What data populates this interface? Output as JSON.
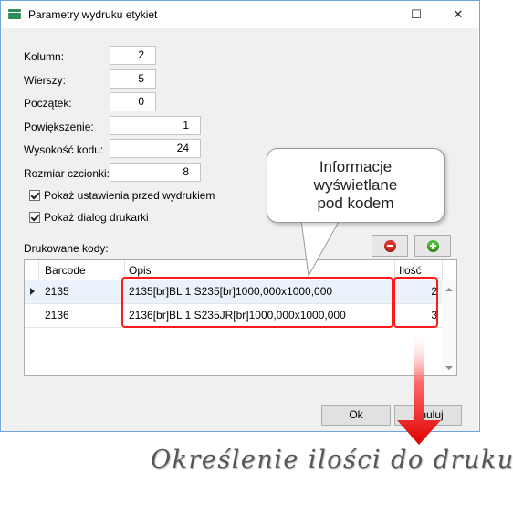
{
  "window": {
    "title": "Parametry wydruku etykiet",
    "controls": {
      "minimize": "—",
      "maximize": "☐",
      "close": "✕"
    }
  },
  "form": {
    "kolumn": {
      "label": "Kolumn:",
      "value": "2"
    },
    "wierszy": {
      "label": "Wierszy:",
      "value": "5"
    },
    "poczatek": {
      "label": "Początek:",
      "value": "0"
    },
    "powiekszenie": {
      "label": "Powiększenie:",
      "value": "1"
    },
    "wysokosc": {
      "label": "Wysokość kodu:",
      "value": "24"
    },
    "rozmiar": {
      "label": "Rozmiar czcionki:",
      "value": "8"
    },
    "check_settings": {
      "label": "Pokaż ustawienia przed wydrukiem",
      "checked": true
    },
    "check_dialog": {
      "label": "Pokaż dialog drukarki",
      "checked": true
    }
  },
  "codes": {
    "label": "Drukowane kody:",
    "columns": [
      "Barcode",
      "Opis",
      "Ilość"
    ],
    "rows": [
      {
        "barcode": "2135",
        "opis": "2135[br]BL 1 S235[br]1000,000x1000,000",
        "ilosc": "2",
        "selected": true
      },
      {
        "barcode": "2136",
        "opis": "2136[br]BL 1 S235JR[br]1000,000x1000,000",
        "ilosc": "3",
        "selected": false
      }
    ]
  },
  "buttons": {
    "ok": "Ok",
    "cancel": "Anuluj"
  },
  "annotations": {
    "callout_line1": "Informacje",
    "callout_line2": "wyświetlane",
    "callout_line3": "pod kodem",
    "caption": "Określenie ilości do druku",
    "highlight_color": "#ff1a1a"
  }
}
